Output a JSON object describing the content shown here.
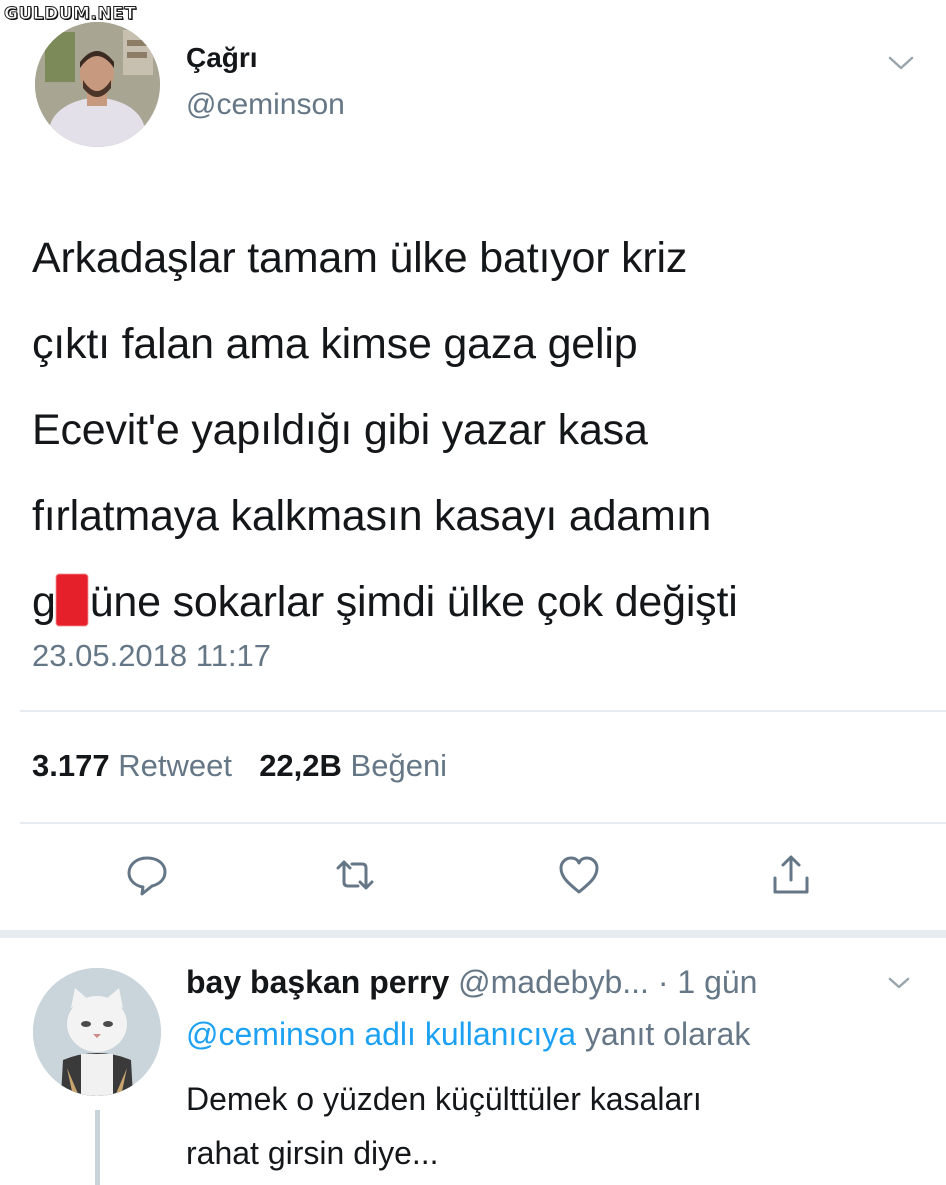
{
  "watermark": "GULDUM.NET",
  "tweet": {
    "author_name": "Çağrı",
    "author_handle": "@ceminson",
    "text_lines": [
      "Arkadaşlar tamam ülke batıyor kriz",
      "çıktı falan ama kimse gaza gelip",
      "Ecevit'e yapıldığı gibi yazar kasa",
      "fırlatmaya kalkmasın kasayı adamın"
    ],
    "last_line_prefix": "g",
    "last_line_suffix": "üne sokarlar şimdi ülke çok değişti",
    "timestamp": "23.05.2018 11:17",
    "retweet_count": "3.177",
    "retweet_label": "Retweet",
    "like_count": "22,2B",
    "like_label": "Beğeni",
    "icons": [
      "reply-icon",
      "retweet-icon",
      "like-icon",
      "share-icon",
      "chevron-down-icon"
    ]
  },
  "reply": {
    "author_name": "bay başkan perry",
    "author_handle": "@madebyb...",
    "time": "· 1 gün",
    "reply_to_link": "@ceminson adlı kullanıcıya",
    "reply_to_suffix": "yanıt olarak",
    "text_lines": [
      "Demek o yüzden küçülttüler kasaları",
      "rahat girsin diye..."
    ]
  },
  "colors": {
    "accent": "#1da1f2",
    "secondary_text": "#657786",
    "primary_text": "#14171a",
    "divider": "#e6ecf0",
    "redaction": "#e6202a"
  }
}
